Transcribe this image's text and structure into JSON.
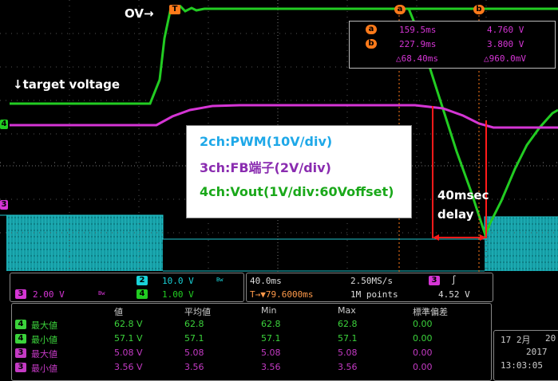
{
  "annotations": {
    "ov_label": "OV→",
    "target_label": "↓target voltage",
    "delay_label_1": "40msec",
    "delay_label_2": "delay"
  },
  "trigger_marker": "T",
  "cursor_markers": {
    "a": "a",
    "b": "b"
  },
  "channel_markers": {
    "ch4": "4",
    "ch3": "3",
    "ch2": "2"
  },
  "cursor_readout": {
    "a_time": "159.5ms",
    "a_volt": "4.760 V",
    "b_time": "227.9ms",
    "b_volt": "3.800 V",
    "delta_time": "△68.40ms",
    "delta_volt": "△960.0mV"
  },
  "legend": {
    "line1": "2ch:PWM(10V/div)",
    "line2": "3ch:FB端子(2V/div)",
    "line3": "4ch:Vout(1V/div:60Voffset)"
  },
  "status": {
    "ch3_num": "3",
    "ch3_scale": "2.00 V",
    "ch3_bw": "Bw",
    "ch2_num": "2",
    "ch2_scale": "10.0 V",
    "ch2_bw": "Bw",
    "ch4_num": "4",
    "ch4_scale": "1.00 V",
    "timebase": "40.0ms",
    "samplerate": "2.50MS/s",
    "trig_pos": "T→▼79.6000ms",
    "points": "1M points",
    "trig_ch": "3",
    "trig_slope": "∫",
    "trig_level": "4.52 V"
  },
  "measure": {
    "headers": [
      "値",
      "平均値",
      "Min",
      "Max",
      "標準偏差"
    ],
    "rows": [
      {
        "ch": "4",
        "name": "最大値",
        "vals": [
          "62.8 V",
          "62.8",
          "62.8",
          "62.8",
          "0.00"
        ],
        "color": "#3bd23b"
      },
      {
        "ch": "4",
        "name": "最小値",
        "vals": [
          "57.1 V",
          "57.1",
          "57.1",
          "57.1",
          "0.00"
        ],
        "color": "#3bd23b"
      },
      {
        "ch": "3",
        "name": "最大値",
        "vals": [
          "5.08 V",
          "5.08",
          "5.08",
          "5.08",
          "0.00"
        ],
        "color": "#c43ac4"
      },
      {
        "ch": "3",
        "name": "最小値",
        "vals": [
          "3.56 V",
          "3.56",
          "3.56",
          "3.56",
          "0.00"
        ],
        "color": "#c43ac4"
      }
    ]
  },
  "date": {
    "line1": "17 2月",
    "line1b": "20",
    "line2": "2017",
    "time": "13:03:05"
  },
  "colors": {
    "ch2": "#19d2d8",
    "ch3": "#d535d5",
    "ch4": "#22cc22",
    "cursor": "#ff7a1a",
    "delay_marker": "#ff1a1a"
  }
}
